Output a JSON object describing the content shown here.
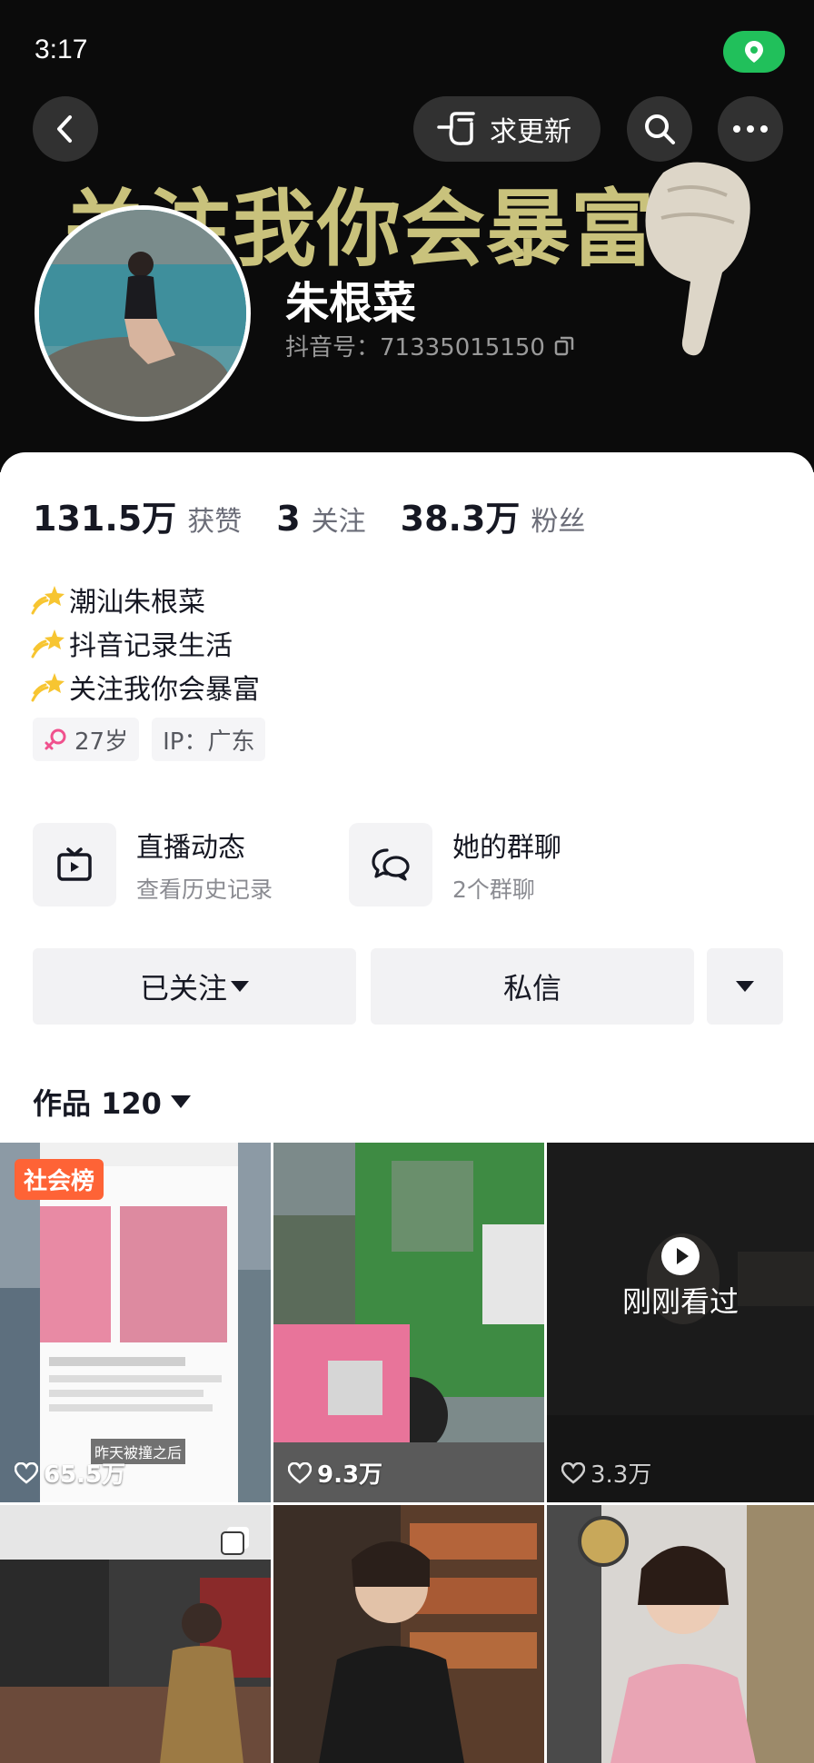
{
  "status_bar": {
    "time": "3:17"
  },
  "header": {
    "banner_text": "关注我你会暴富",
    "update_label": "求更新",
    "nickname": "朱根菜",
    "douyin_id": "抖音号：71335015150"
  },
  "stats": [
    {
      "num": "131.5万",
      "label": "获赞"
    },
    {
      "num": "3",
      "label": "关注"
    },
    {
      "num": "38.3万",
      "label": "粉丝"
    }
  ],
  "bio": [
    "潮汕朱根菜",
    "抖音记录生活",
    "关注我你会暴富"
  ],
  "tags": {
    "age": "27岁",
    "ip": "IP：广东"
  },
  "features": {
    "live": {
      "title": "直播动态",
      "sub": "查看历史记录"
    },
    "group": {
      "title": "她的群聊",
      "sub": "2个群聊"
    }
  },
  "buttons": {
    "followed": "已关注",
    "message": "私信"
  },
  "works": {
    "label": "作品 120"
  },
  "videos": [
    {
      "likes": "65.5万",
      "badge": "社会榜",
      "caption": "昨天被撞之后"
    },
    {
      "likes": "9.3万"
    },
    {
      "likes": "3.3万",
      "overlay": "刚刚看过"
    },
    {
      "likes": ""
    },
    {
      "likes": ""
    },
    {
      "likes": ""
    }
  ],
  "colors": {
    "accent_green": "#21c05b",
    "rank_tag": "#fe6336",
    "banner_text": "#c9c27c"
  }
}
